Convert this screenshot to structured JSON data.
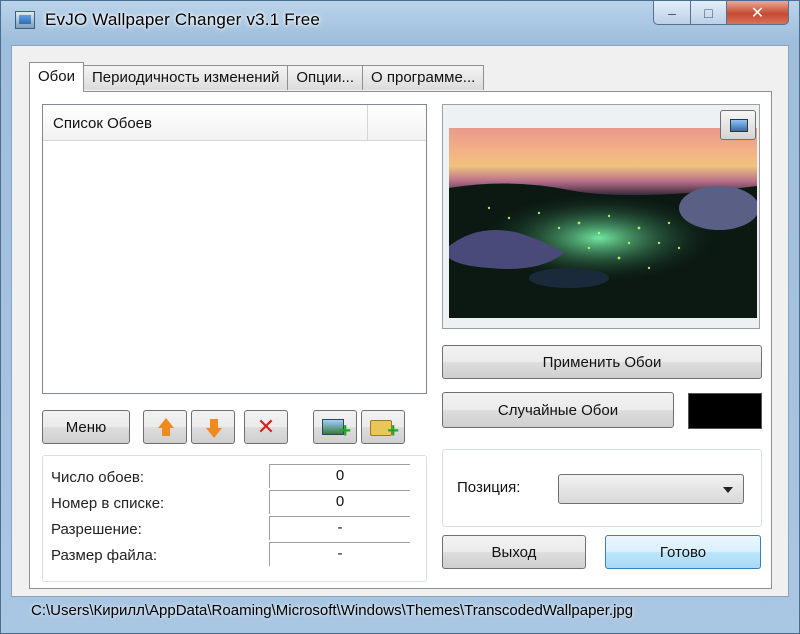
{
  "window": {
    "title": "EvJO Wallpaper Changer v3.1 Free",
    "caption_min": "–",
    "caption_max": "□",
    "caption_close": "✕"
  },
  "tabs": [
    {
      "label": "Обои",
      "active": true
    },
    {
      "label": "Периодичность изменений",
      "active": false
    },
    {
      "label": "Опции...",
      "active": false
    },
    {
      "label": "О программе...",
      "active": false
    }
  ],
  "list": {
    "header": "Список Обоев",
    "items": []
  },
  "toolbar": {
    "menu_label": "Меню",
    "icons": [
      "arrow-up-icon",
      "arrow-down-icon",
      "delete-icon",
      "add-image-icon",
      "add-folder-icon"
    ],
    "delete_glyph": "✕",
    "plus_glyph": "+"
  },
  "info": {
    "rows": [
      {
        "label": "Число обоев:",
        "value": "0"
      },
      {
        "label": "Номер в списке:",
        "value": "0"
      },
      {
        "label": "Разрешение:",
        "value": "-"
      },
      {
        "label": "Размер файла:",
        "value": "-"
      }
    ]
  },
  "preview": {
    "apply_label": "Применить Обои",
    "random_label": "Случайные Обои",
    "color_swatch": "#000000"
  },
  "position": {
    "label": "Позиция:",
    "selected": ""
  },
  "footer": {
    "exit_label": "Выход",
    "done_label": "Готово"
  },
  "status": {
    "path": "C:\\Users\\Кирилл\\AppData\\Roaming\\Microsoft\\Windows\\Themes\\TranscodedWallpaper.jpg"
  }
}
